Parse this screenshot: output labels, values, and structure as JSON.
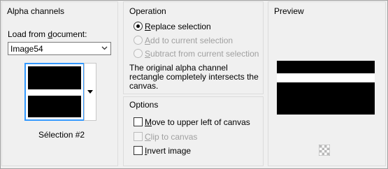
{
  "alpha_channels": {
    "title": "Alpha channels",
    "load_from_document_label": "Load from document:",
    "document_value": "Image54",
    "selection_name": "Sélection #2"
  },
  "operation": {
    "title": "Operation",
    "options": [
      {
        "label": "Replace selection",
        "selected": true,
        "enabled": true
      },
      {
        "label": "Add to current selection",
        "selected": false,
        "enabled": false
      },
      {
        "label": "Subtract from current selection",
        "selected": false,
        "enabled": false
      }
    ],
    "note": "The original alpha channel rectangle completely intersects the canvas."
  },
  "options": {
    "title": "Options",
    "items": [
      {
        "label": "Move to upper left of canvas",
        "checked": false,
        "enabled": true
      },
      {
        "label": "Clip to canvas",
        "checked": false,
        "enabled": false
      },
      {
        "label": "Invert image",
        "checked": false,
        "enabled": true
      }
    ]
  },
  "preview": {
    "title": "Preview",
    "icon": "checkerboard-icon"
  }
}
